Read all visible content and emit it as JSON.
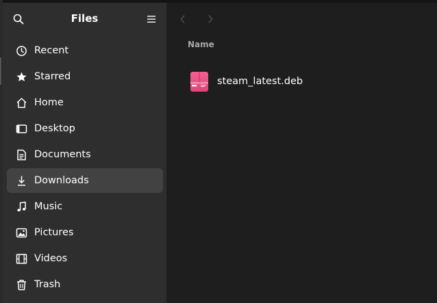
{
  "sidebar": {
    "title": "Files",
    "search_icon": "search-icon",
    "menu_icon": "hamburger-menu-icon",
    "items": [
      {
        "label": "Recent",
        "icon": "clock-icon"
      },
      {
        "label": "Starred",
        "icon": "star-icon"
      },
      {
        "label": "Home",
        "icon": "home-icon"
      },
      {
        "label": "Desktop",
        "icon": "desktop-icon"
      },
      {
        "label": "Documents",
        "icon": "document-icon"
      },
      {
        "label": "Downloads",
        "icon": "download-icon",
        "active": true
      },
      {
        "label": "Music",
        "icon": "music-note-icon"
      },
      {
        "label": "Pictures",
        "icon": "picture-icon"
      },
      {
        "label": "Videos",
        "icon": "film-icon"
      },
      {
        "label": "Trash",
        "icon": "trash-icon"
      }
    ]
  },
  "main": {
    "back_icon": "chevron-left-icon",
    "forward_icon": "chevron-right-icon",
    "column_header": "Name",
    "files": [
      {
        "name": "steam_latest.deb",
        "icon": "deb-package-icon"
      }
    ]
  },
  "colors": {
    "sidebar_bg": "#2e2e2e",
    "main_bg": "#1e1e1e",
    "active_item_bg": "#424242",
    "package_icon": "#e9477a"
  }
}
